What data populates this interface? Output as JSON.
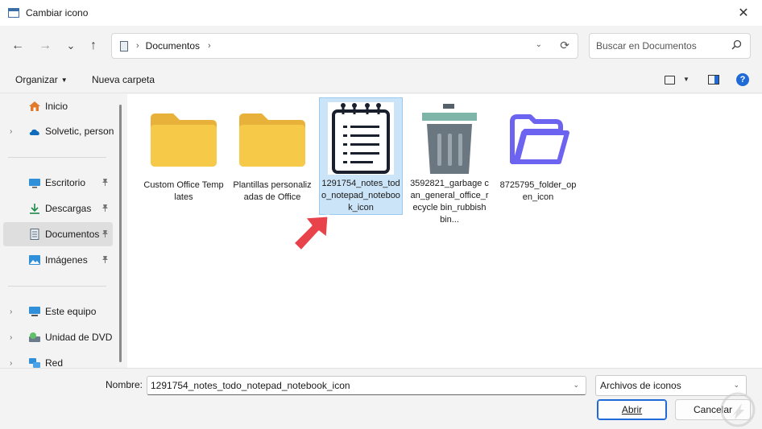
{
  "window": {
    "title": "Cambiar icono",
    "close_glyph": "✕"
  },
  "nav": {
    "back_glyph": "←",
    "forward_glyph": "→",
    "recent_glyph": "⌄",
    "up_glyph": "↑"
  },
  "address": {
    "separator": "›",
    "crumb": "Documentos",
    "trailing_separator": "›",
    "dropdown_glyph": "⌄",
    "refresh_glyph": "⟳"
  },
  "search": {
    "placeholder": "Buscar en Documentos",
    "icon": "magnifier-icon"
  },
  "toolbar": {
    "organize_label": "Organizar",
    "organize_caret": "▼",
    "new_folder_label": "Nueva carpeta",
    "view_caret": "▼",
    "help_glyph": "?"
  },
  "sidebar": {
    "chev_glyph": "›",
    "pin_glyph": "📌",
    "items": [
      {
        "label": "Inicio",
        "icon": "home-icon"
      },
      {
        "label": "Solvetic, person",
        "icon": "onedrive-cloud-icon"
      },
      {
        "label": "Escritorio",
        "icon": "desktop-icon"
      },
      {
        "label": "Descargas",
        "icon": "download-icon"
      },
      {
        "label": "Documentos",
        "icon": "document-icon"
      },
      {
        "label": "Imágenes",
        "icon": "pictures-icon"
      },
      {
        "label": "Este equipo",
        "icon": "computer-icon"
      },
      {
        "label": "Unidad de DVD",
        "icon": "dvd-drive-icon"
      },
      {
        "label": "Red",
        "icon": "network-icon"
      }
    ]
  },
  "files": [
    {
      "name": "Custom Office Templates",
      "icon": "folder-icon"
    },
    {
      "name": "Plantillas personalizadas de Office",
      "icon": "folder-icon"
    },
    {
      "name": "1291754_notes_todo_notepad_notebook_icon",
      "icon": "notepad-icon",
      "selected": true
    },
    {
      "name": "3592821_garbage can_general_office_recycle bin_rubbish bin...",
      "icon": "trash-can-icon"
    },
    {
      "name": "8725795_folder_open_icon",
      "icon": "open-folder-icon"
    }
  ],
  "footer": {
    "name_label": "Nombre:",
    "filename_value": "1291754_notes_todo_notepad_notebook_icon",
    "filetype_value": "Archivos de iconos",
    "dropdown_glyph": "⌄",
    "open_label": "Abrir",
    "cancel_label": "Cancelar"
  },
  "colors": {
    "accent": "#1f6ad6",
    "selection": "#cce4f7",
    "folder": "#f7c948",
    "pointer_arrow": "#e8424a"
  }
}
